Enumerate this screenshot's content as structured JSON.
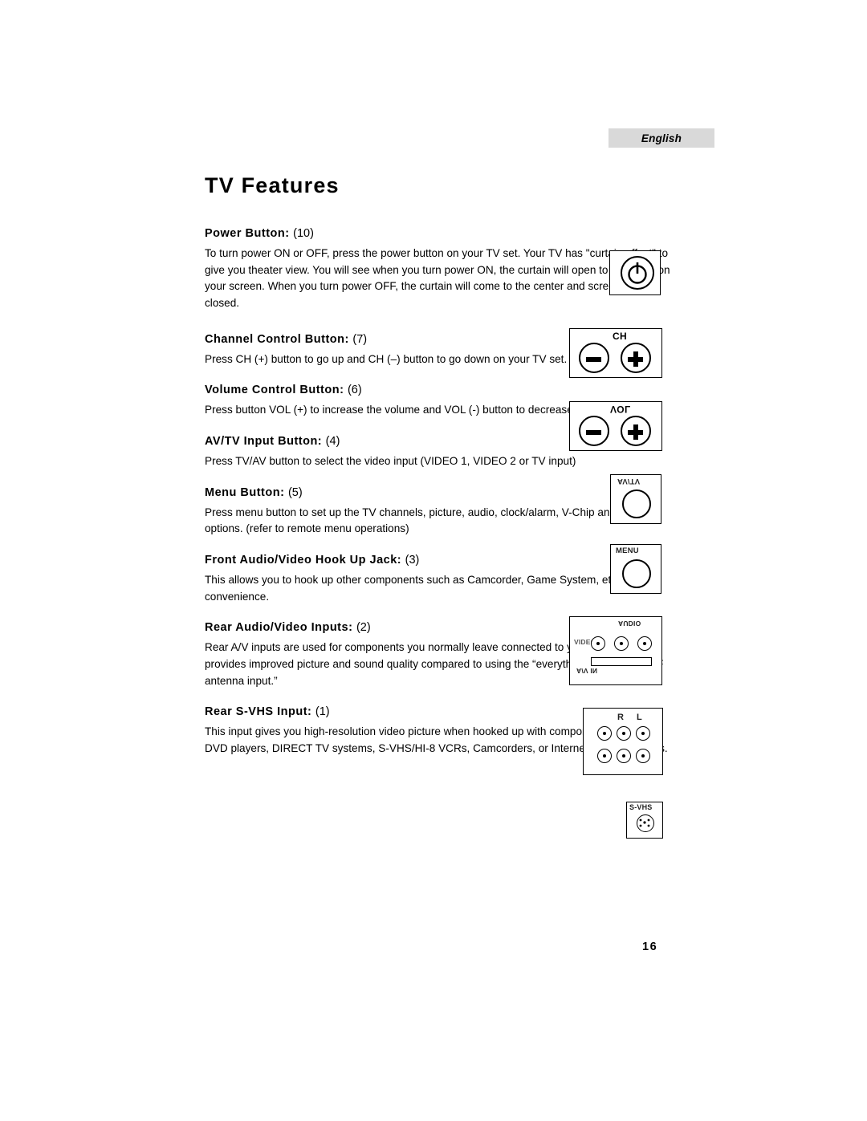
{
  "language_tag": "English",
  "page_title": "TV Features",
  "page_number": "16",
  "sections": [
    {
      "heading": "Power Button:",
      "number": "(10)",
      "body": "To turn power ON or OFF, press the power button on your TV set. Your TV has \"curtain effect\" to give you theater view. You will see when you turn power ON, the curtain will open to the sides on your screen. When you turn power OFF, the curtain will come to the center and screen will be closed."
    },
    {
      "heading": "Channel Control Button:",
      "number": "(7)",
      "body": "Press CH (+) button to go up and CH (–) button to go down on your TV set."
    },
    {
      "heading": "Volume Control Button:",
      "number": "(6)",
      "body": "Press button VOL (+) to increase the volume and VOL (-) button to decrease the volume."
    },
    {
      "heading": "AV/TV Input Button:",
      "number": "(4)",
      "body": "Press TV/AV button to select the video input (VIDEO 1, VIDEO 2 or TV input)"
    },
    {
      "heading": "Menu Button:",
      "number": "(5)",
      "body": "Press menu button to set up the TV channels, picture, audio, clock/alarm, V-Chip and other options. (refer to remote menu operations)"
    },
    {
      "heading": "Front Audio/Video Hook Up Jack:",
      "number": "(3)",
      "body": "This allows you to hook up other components such as Camcorder, Game System, etc. for your convenience."
    },
    {
      "heading": "Rear Audio/Video Inputs:",
      "number": "(2)",
      "body": "Rear A/V inputs are used for components you normally leave connected to your TV. This provides improved picture and sound quality compared to using the “everything on one wire RF antenna input.”"
    },
    {
      "heading": "Rear S-VHS Input:",
      "number": "(1)",
      "body": "This input gives you high-resolution video picture when hooked up with components such as DVD players, DIRECT TV systems, S-VHS/HI-8 VCRs, Camcorders, or Internet set-top devices."
    }
  ],
  "figures": {
    "power": {
      "label": "power-symbol"
    },
    "channel": {
      "label": "CH"
    },
    "volume": {
      "label": "VOL"
    },
    "avtv": {
      "label": "AV/TV"
    },
    "menu": {
      "label": "MENU"
    },
    "front_av": {
      "label_top": "AUDIO",
      "label_left": "VIDEO",
      "label_bottom": "A/V IN"
    },
    "rear_av": {
      "label_r": "R",
      "label_l": "L"
    },
    "svhs": {
      "label": "S-VHS"
    }
  }
}
